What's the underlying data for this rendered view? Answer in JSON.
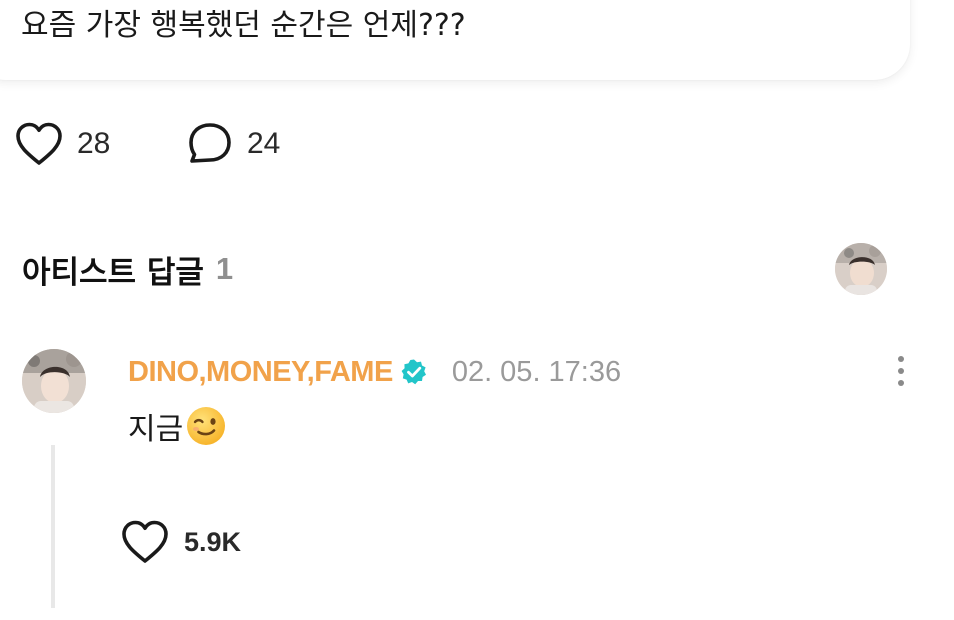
{
  "post": {
    "text": "요즘 가장 행복했던 순간은 언제???",
    "like_count": "28",
    "comment_count": "24"
  },
  "artist_replies": {
    "title": "아티스트 답글",
    "count": "1"
  },
  "comment": {
    "author": "DINO,MONEY,FAME",
    "timestamp": "02. 05. 17:36",
    "text": "지금",
    "emoji": "winking-face",
    "like_count": "5.9K"
  },
  "icons": {
    "like": "heart-outline-icon",
    "comment": "speech-bubble-outline-icon",
    "verified": "verified-badge-icon",
    "more": "more-vertical-icon"
  },
  "colors": {
    "author_name": "#f1a24a",
    "verified_badge": "#22c5c9",
    "timestamp": "#9a9a9a",
    "count_muted": "#8f8f8f"
  }
}
